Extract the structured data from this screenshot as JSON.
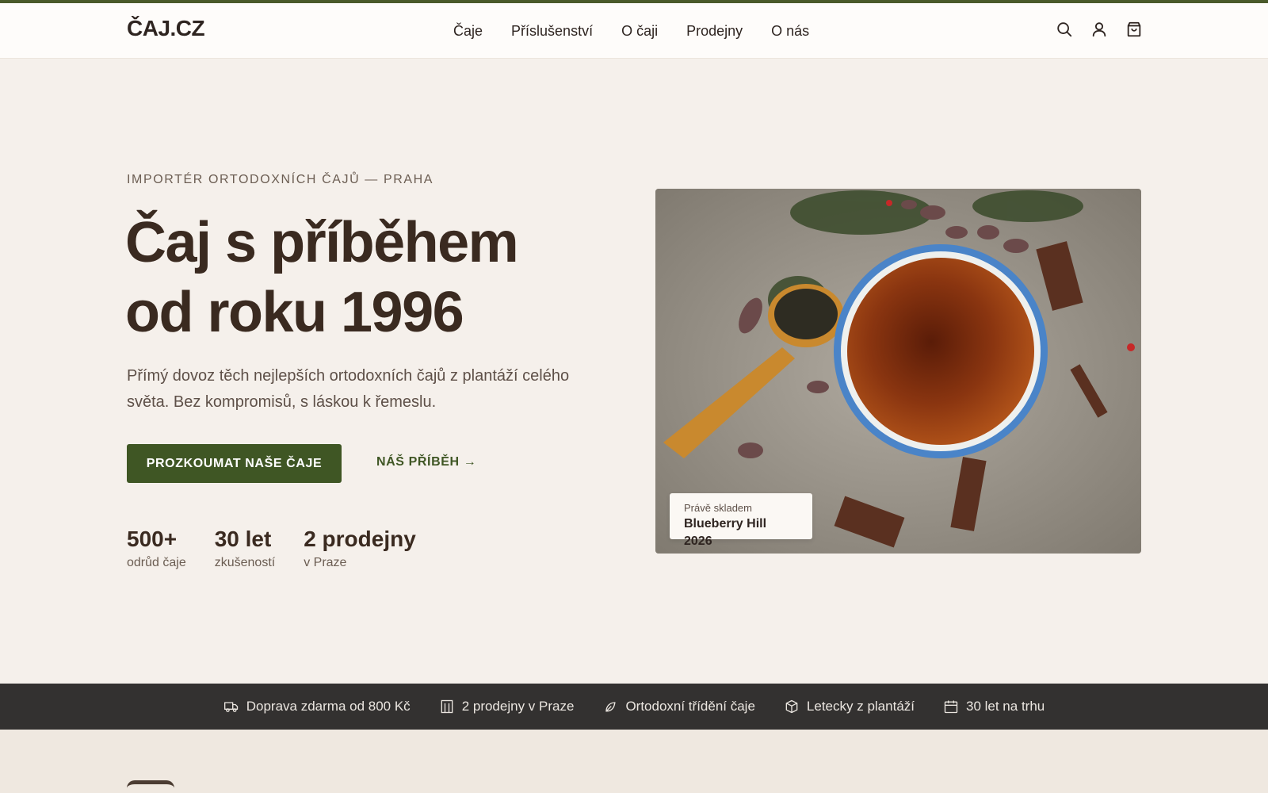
{
  "brand": {
    "logo": "ČAJ.CZ",
    "accent": "#3f5624",
    "dark": "#3a2a20"
  },
  "nav": {
    "items": [
      {
        "label": "Čaje"
      },
      {
        "label": "Příslušenství"
      },
      {
        "label": "O čaji"
      },
      {
        "label": "Prodejny"
      },
      {
        "label": "O nás"
      }
    ],
    "icons": [
      "search-icon",
      "user-icon",
      "cart-icon"
    ]
  },
  "hero": {
    "eyebrow": "IMPORTÉR ORTODOXNÍCH ČAJŮ — PRAHA",
    "title_line1": "Čaj s příběhem",
    "title_line2": "od roku 1996",
    "lead": "Přímý dovoz těch nejlepších ortodoxních čajů z plantáží celého světa. Bez kompromisů, s láskou k řemeslu.",
    "primary_button": "PROZKOUMAT NAŠE ČAJE",
    "secondary_link": "NÁŠ PŘÍBĚH →",
    "stats": [
      {
        "value": "500+",
        "label": "odrůd čaje"
      },
      {
        "value": "30 let",
        "label": "zkušeností"
      },
      {
        "value": "2 prodejny",
        "label": "v Praze"
      }
    ],
    "image_badge": {
      "small": "Právě skladem",
      "big": "Blueberry Hill 2026"
    }
  },
  "features": [
    {
      "icon": "truck-icon",
      "label": "Doprava zdarma od 800 Kč"
    },
    {
      "icon": "store-icon",
      "label": "2 prodejny v Praze"
    },
    {
      "icon": "leaf-icon",
      "label": "Ortodoxní třídění čaje"
    },
    {
      "icon": "box-icon",
      "label": "Letecky z plantáží"
    },
    {
      "icon": "calendar-icon",
      "label": "30 let na trhu"
    }
  ]
}
